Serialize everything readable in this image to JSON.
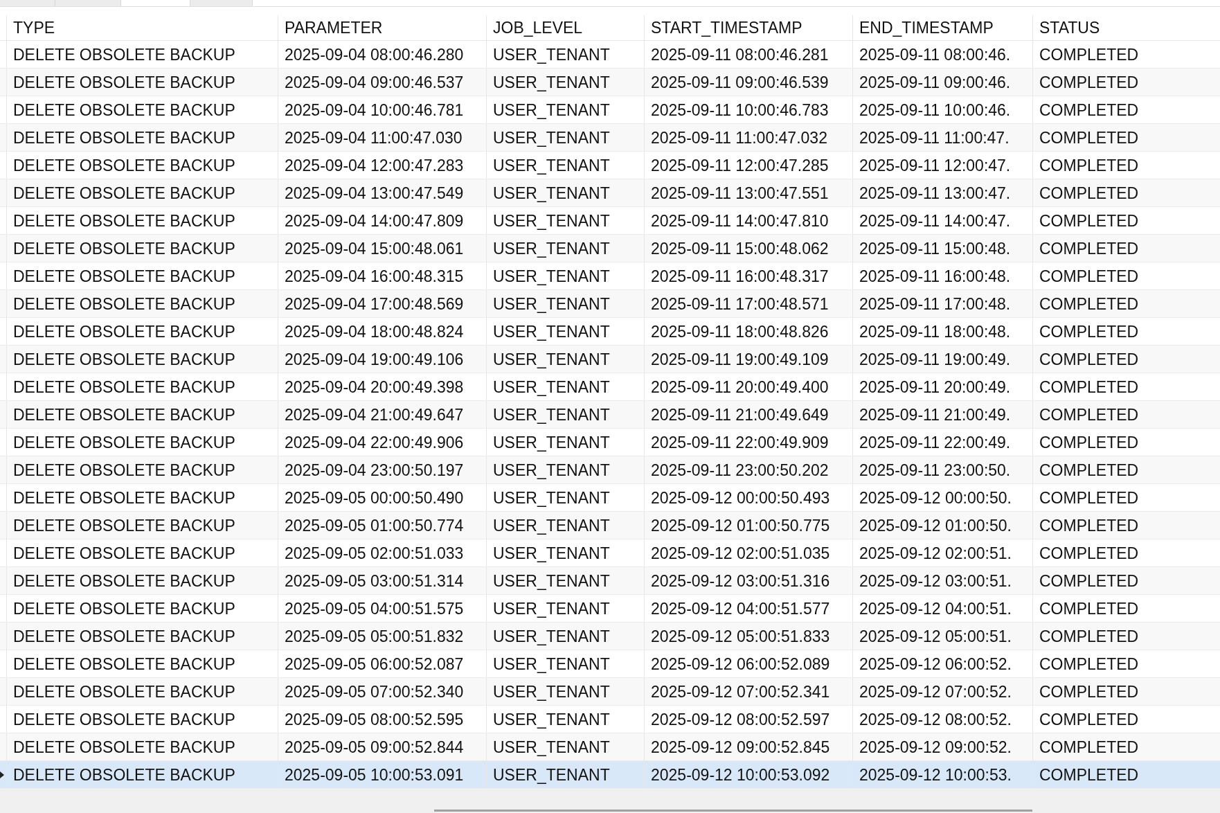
{
  "tabs": [
    {
      "selected": false
    },
    {
      "selected": false
    },
    {
      "selected": true
    },
    {
      "selected": false
    }
  ],
  "table": {
    "columns": [
      "TYPE",
      "PARAMETER",
      "JOB_LEVEL",
      "START_TIMESTAMP",
      "END_TIMESTAMP",
      "STATUS"
    ],
    "rows": [
      {
        "selected": false,
        "cells": [
          "DELETE OBSOLETE BACKUP",
          "2025-09-04 08:00:46.280",
          "USER_TENANT",
          "2025-09-11 08:00:46.281",
          "2025-09-11 08:00:46.",
          "COMPLETED"
        ]
      },
      {
        "selected": false,
        "cells": [
          "DELETE OBSOLETE BACKUP",
          "2025-09-04 09:00:46.537",
          "USER_TENANT",
          "2025-09-11 09:00:46.539",
          "2025-09-11 09:00:46.",
          "COMPLETED"
        ]
      },
      {
        "selected": false,
        "cells": [
          "DELETE OBSOLETE BACKUP",
          "2025-09-04 10:00:46.781",
          "USER_TENANT",
          "2025-09-11 10:00:46.783",
          "2025-09-11 10:00:46.",
          "COMPLETED"
        ]
      },
      {
        "selected": false,
        "cells": [
          "DELETE OBSOLETE BACKUP",
          "2025-09-04 11:00:47.030",
          "USER_TENANT",
          "2025-09-11 11:00:47.032",
          "2025-09-11 11:00:47.",
          "COMPLETED"
        ]
      },
      {
        "selected": false,
        "cells": [
          "DELETE OBSOLETE BACKUP",
          "2025-09-04 12:00:47.283",
          "USER_TENANT",
          "2025-09-11 12:00:47.285",
          "2025-09-11 12:00:47.",
          "COMPLETED"
        ]
      },
      {
        "selected": false,
        "cells": [
          "DELETE OBSOLETE BACKUP",
          "2025-09-04 13:00:47.549",
          "USER_TENANT",
          "2025-09-11 13:00:47.551",
          "2025-09-11 13:00:47.",
          "COMPLETED"
        ]
      },
      {
        "selected": false,
        "cells": [
          "DELETE OBSOLETE BACKUP",
          "2025-09-04 14:00:47.809",
          "USER_TENANT",
          "2025-09-11 14:00:47.810",
          "2025-09-11 14:00:47.",
          "COMPLETED"
        ]
      },
      {
        "selected": false,
        "cells": [
          "DELETE OBSOLETE BACKUP",
          "2025-09-04 15:00:48.061",
          "USER_TENANT",
          "2025-09-11 15:00:48.062",
          "2025-09-11 15:00:48.",
          "COMPLETED"
        ]
      },
      {
        "selected": false,
        "cells": [
          "DELETE OBSOLETE BACKUP",
          "2025-09-04 16:00:48.315",
          "USER_TENANT",
          "2025-09-11 16:00:48.317",
          "2025-09-11 16:00:48.",
          "COMPLETED"
        ]
      },
      {
        "selected": false,
        "cells": [
          "DELETE OBSOLETE BACKUP",
          "2025-09-04 17:00:48.569",
          "USER_TENANT",
          "2025-09-11 17:00:48.571",
          "2025-09-11 17:00:48.",
          "COMPLETED"
        ]
      },
      {
        "selected": false,
        "cells": [
          "DELETE OBSOLETE BACKUP",
          "2025-09-04 18:00:48.824",
          "USER_TENANT",
          "2025-09-11 18:00:48.826",
          "2025-09-11 18:00:48.",
          "COMPLETED"
        ]
      },
      {
        "selected": false,
        "cells": [
          "DELETE OBSOLETE BACKUP",
          "2025-09-04 19:00:49.106",
          "USER_TENANT",
          "2025-09-11 19:00:49.109",
          "2025-09-11 19:00:49.",
          "COMPLETED"
        ]
      },
      {
        "selected": false,
        "cells": [
          "DELETE OBSOLETE BACKUP",
          "2025-09-04 20:00:49.398",
          "USER_TENANT",
          "2025-09-11 20:00:49.400",
          "2025-09-11 20:00:49.",
          "COMPLETED"
        ]
      },
      {
        "selected": false,
        "cells": [
          "DELETE OBSOLETE BACKUP",
          "2025-09-04 21:00:49.647",
          "USER_TENANT",
          "2025-09-11 21:00:49.649",
          "2025-09-11 21:00:49.",
          "COMPLETED"
        ]
      },
      {
        "selected": false,
        "cells": [
          "DELETE OBSOLETE BACKUP",
          "2025-09-04 22:00:49.906",
          "USER_TENANT",
          "2025-09-11 22:00:49.909",
          "2025-09-11 22:00:49.",
          "COMPLETED"
        ]
      },
      {
        "selected": false,
        "cells": [
          "DELETE OBSOLETE BACKUP",
          "2025-09-04 23:00:50.197",
          "USER_TENANT",
          "2025-09-11 23:00:50.202",
          "2025-09-11 23:00:50.",
          "COMPLETED"
        ]
      },
      {
        "selected": false,
        "cells": [
          "DELETE OBSOLETE BACKUP",
          "2025-09-05 00:00:50.490",
          "USER_TENANT",
          "2025-09-12 00:00:50.493",
          "2025-09-12 00:00:50.",
          "COMPLETED"
        ]
      },
      {
        "selected": false,
        "cells": [
          "DELETE OBSOLETE BACKUP",
          "2025-09-05 01:00:50.774",
          "USER_TENANT",
          "2025-09-12 01:00:50.775",
          "2025-09-12 01:00:50.",
          "COMPLETED"
        ]
      },
      {
        "selected": false,
        "cells": [
          "DELETE OBSOLETE BACKUP",
          "2025-09-05 02:00:51.033",
          "USER_TENANT",
          "2025-09-12 02:00:51.035",
          "2025-09-12 02:00:51.",
          "COMPLETED"
        ]
      },
      {
        "selected": false,
        "cells": [
          "DELETE OBSOLETE BACKUP",
          "2025-09-05 03:00:51.314",
          "USER_TENANT",
          "2025-09-12 03:00:51.316",
          "2025-09-12 03:00:51.",
          "COMPLETED"
        ]
      },
      {
        "selected": false,
        "cells": [
          "DELETE OBSOLETE BACKUP",
          "2025-09-05 04:00:51.575",
          "USER_TENANT",
          "2025-09-12 04:00:51.577",
          "2025-09-12 04:00:51.",
          "COMPLETED"
        ]
      },
      {
        "selected": false,
        "cells": [
          "DELETE OBSOLETE BACKUP",
          "2025-09-05 05:00:51.832",
          "USER_TENANT",
          "2025-09-12 05:00:51.833",
          "2025-09-12 05:00:51.",
          "COMPLETED"
        ]
      },
      {
        "selected": false,
        "cells": [
          "DELETE OBSOLETE BACKUP",
          "2025-09-05 06:00:52.087",
          "USER_TENANT",
          "2025-09-12 06:00:52.089",
          "2025-09-12 06:00:52.",
          "COMPLETED"
        ]
      },
      {
        "selected": false,
        "cells": [
          "DELETE OBSOLETE BACKUP",
          "2025-09-05 07:00:52.340",
          "USER_TENANT",
          "2025-09-12 07:00:52.341",
          "2025-09-12 07:00:52.",
          "COMPLETED"
        ]
      },
      {
        "selected": false,
        "cells": [
          "DELETE OBSOLETE BACKUP",
          "2025-09-05 08:00:52.595",
          "USER_TENANT",
          "2025-09-12 08:00:52.597",
          "2025-09-12 08:00:52.",
          "COMPLETED"
        ]
      },
      {
        "selected": false,
        "cells": [
          "DELETE OBSOLETE BACKUP",
          "2025-09-05 09:00:52.844",
          "USER_TENANT",
          "2025-09-12 09:00:52.845",
          "2025-09-12 09:00:52.",
          "COMPLETED"
        ]
      },
      {
        "selected": true,
        "cells": [
          "DELETE OBSOLETE BACKUP",
          "2025-09-05 10:00:53.091",
          "USER_TENANT",
          "2025-09-12 10:00:53.092",
          "2025-09-12 10:00:53.",
          "COMPLETED"
        ]
      }
    ]
  }
}
